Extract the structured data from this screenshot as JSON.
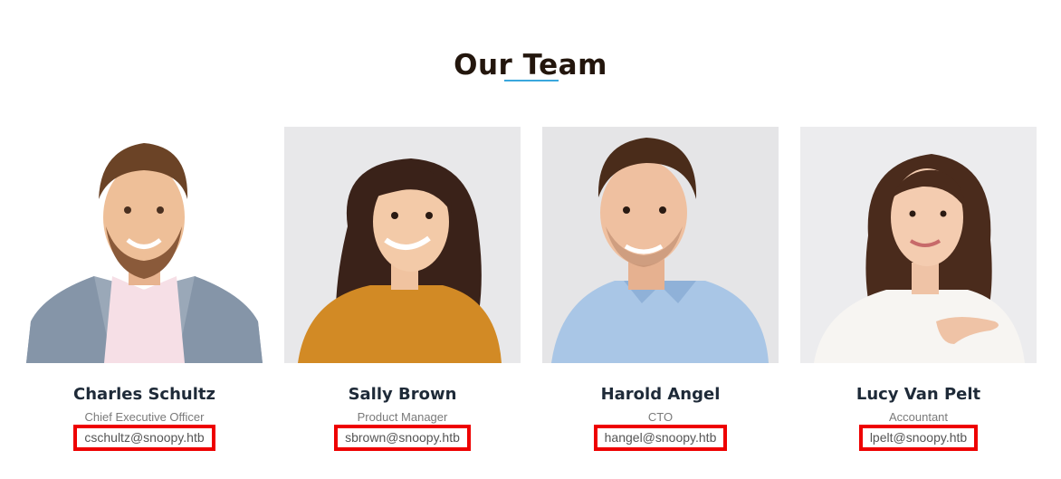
{
  "section": {
    "title": "Our Team"
  },
  "colors": {
    "title": "#23160d",
    "accent_rule": "#3aa7dd",
    "name": "#1e2a38",
    "role": "#7a7a7a",
    "email_highlight": "#ee0000"
  },
  "team": [
    {
      "name": "Charles Schultz",
      "role": "Chief Executive Officer",
      "email": "cschultz@snoopy.htb",
      "photo_icon": "person-photo-man-suit"
    },
    {
      "name": "Sally Brown",
      "role": "Product Manager",
      "email": "sbrown@snoopy.htb",
      "photo_icon": "person-photo-woman-yellow-sweater"
    },
    {
      "name": "Harold Angel",
      "role": "CTO",
      "email": "hangel@snoopy.htb",
      "photo_icon": "person-photo-man-blue-shirt"
    },
    {
      "name": "Lucy Van Pelt",
      "role": "Accountant",
      "email": "lpelt@snoopy.htb",
      "photo_icon": "person-photo-woman-white-blouse"
    }
  ]
}
